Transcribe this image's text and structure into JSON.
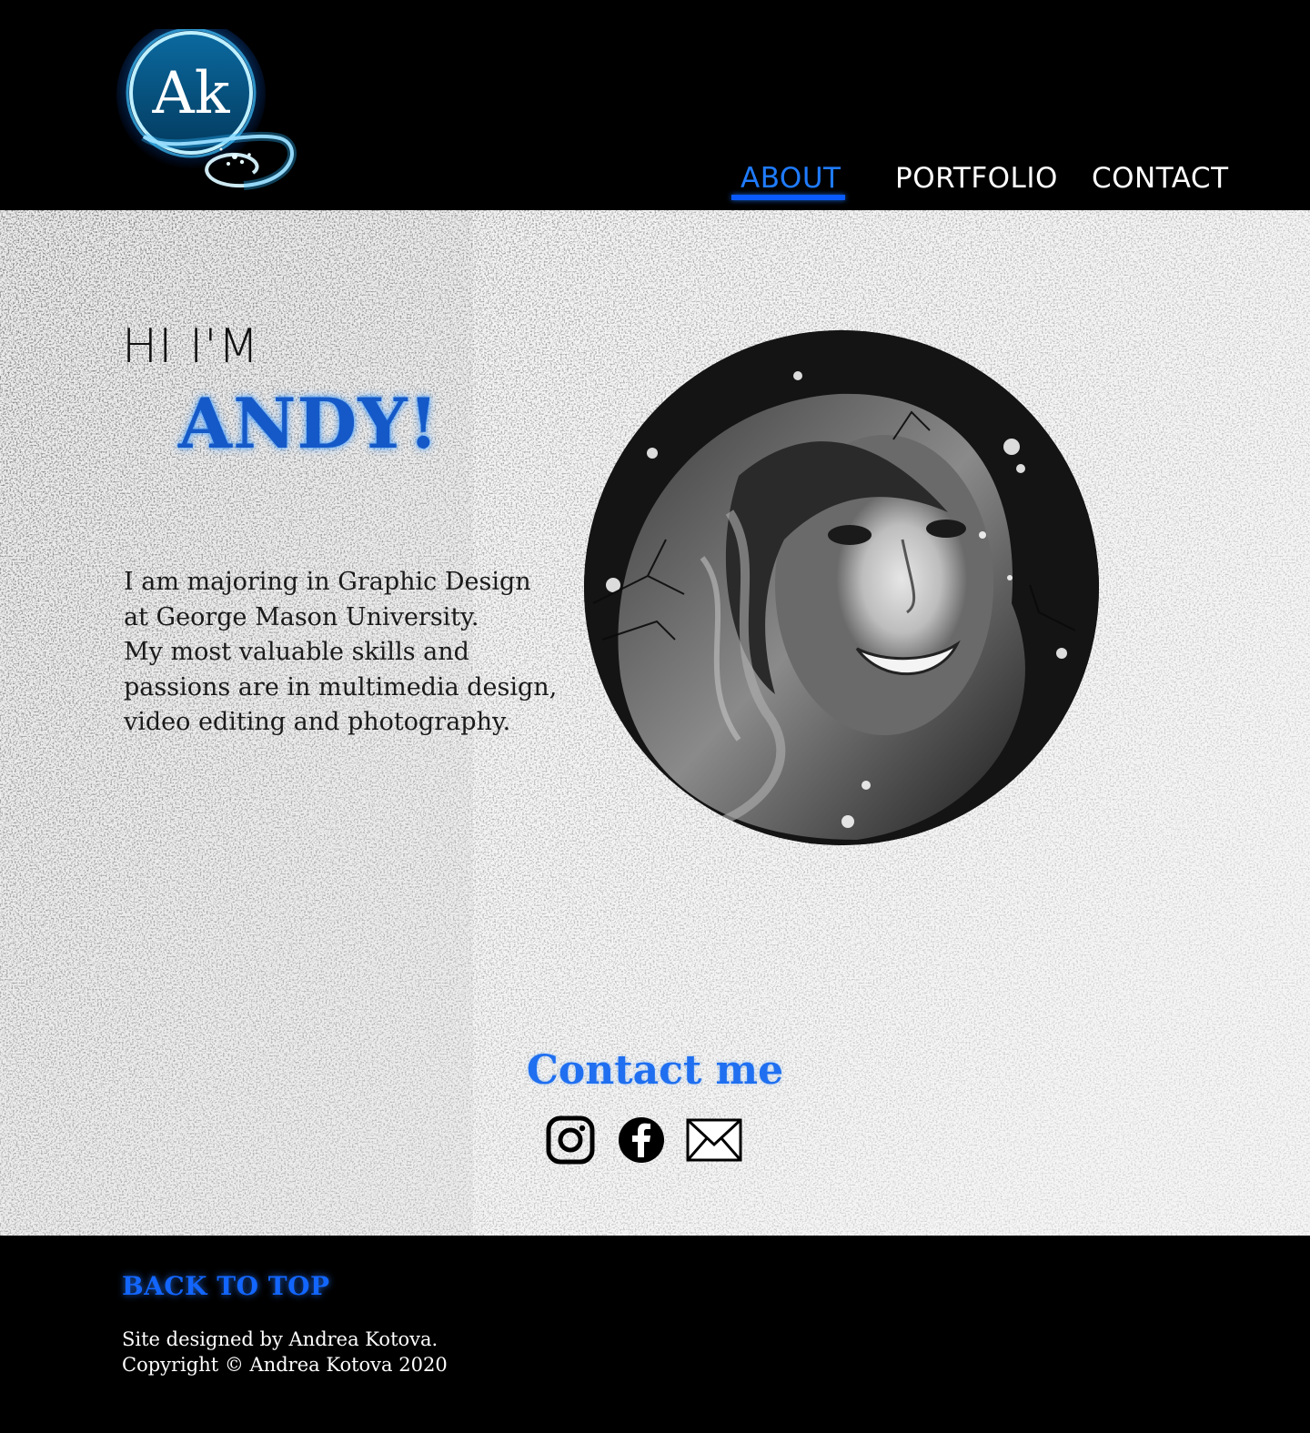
{
  "header": {
    "logo_text": "Ak",
    "nav": [
      {
        "label": "ABOUT",
        "active": true
      },
      {
        "label": "PORTFOLIO",
        "active": false
      },
      {
        "label": "CONTACT",
        "active": false
      }
    ]
  },
  "hero": {
    "greeting": "HI I'M",
    "name": "ANDY!",
    "bio_lines": [
      "I am majoring in Graphic Design",
      "at George Mason University.",
      "My most valuable skills and",
      "passions are in multimedia design,",
      "video editing and photography."
    ]
  },
  "contact": {
    "title": "Contact me",
    "social": [
      "instagram-icon",
      "facebook-icon",
      "mail-icon"
    ]
  },
  "footer": {
    "back_to_top": "BACK TO TOP",
    "credit_line1": "Site designed by Andrea Kotova.",
    "credit_line2": "Copyright © Andrea Kotova 2020"
  },
  "colors": {
    "accent": "#1f7bff",
    "name_blue": "#1559c8",
    "background_dark": "#000000"
  }
}
